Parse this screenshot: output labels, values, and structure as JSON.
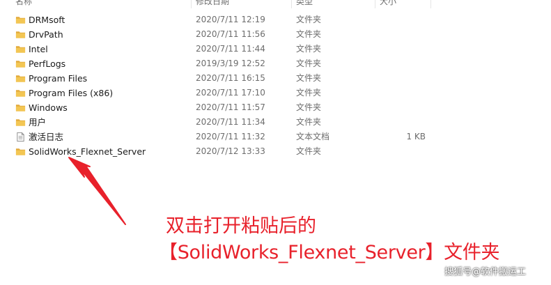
{
  "header": {
    "name": "名称",
    "date": "修改日期",
    "type": "类型",
    "size": "大小"
  },
  "files": [
    {
      "name": "DRMsoft",
      "date": "2020/7/11 12:19",
      "type": "文件夹",
      "size": "",
      "icon": "folder-icon"
    },
    {
      "name": "DrvPath",
      "date": "2020/7/11 11:56",
      "type": "文件夹",
      "size": "",
      "icon": "folder-icon"
    },
    {
      "name": "Intel",
      "date": "2020/7/11 11:44",
      "type": "文件夹",
      "size": "",
      "icon": "folder-icon"
    },
    {
      "name": "PerfLogs",
      "date": "2019/3/19 12:52",
      "type": "文件夹",
      "size": "",
      "icon": "folder-icon"
    },
    {
      "name": "Program Files",
      "date": "2020/7/11 16:15",
      "type": "文件夹",
      "size": "",
      "icon": "folder-icon"
    },
    {
      "name": "Program Files (x86)",
      "date": "2020/7/11 17:10",
      "type": "文件夹",
      "size": "",
      "icon": "folder-icon"
    },
    {
      "name": "Windows",
      "date": "2020/7/11 11:57",
      "type": "文件夹",
      "size": "",
      "icon": "folder-icon"
    },
    {
      "name": "用户",
      "date": "2020/7/11 11:34",
      "type": "文件夹",
      "size": "",
      "icon": "folder-icon"
    },
    {
      "name": "激活日志",
      "date": "2020/7/11 11:32",
      "type": "文本文档",
      "size": "1 KB",
      "icon": "text-file-icon"
    },
    {
      "name": "SolidWorks_Flexnet_Server",
      "date": "2020/7/12 13:33",
      "type": "文件夹",
      "size": "",
      "icon": "folder-icon"
    }
  ],
  "annotation": {
    "line1": "双击打开粘贴后的",
    "line2": "【SolidWorks_Flexnet_Server】文件夹"
  },
  "watermark": "搜狐号@软件搬运工",
  "colors": {
    "annotation": "#e8212b",
    "folder": "#f3c653",
    "folder_dark": "#e2a93a"
  }
}
